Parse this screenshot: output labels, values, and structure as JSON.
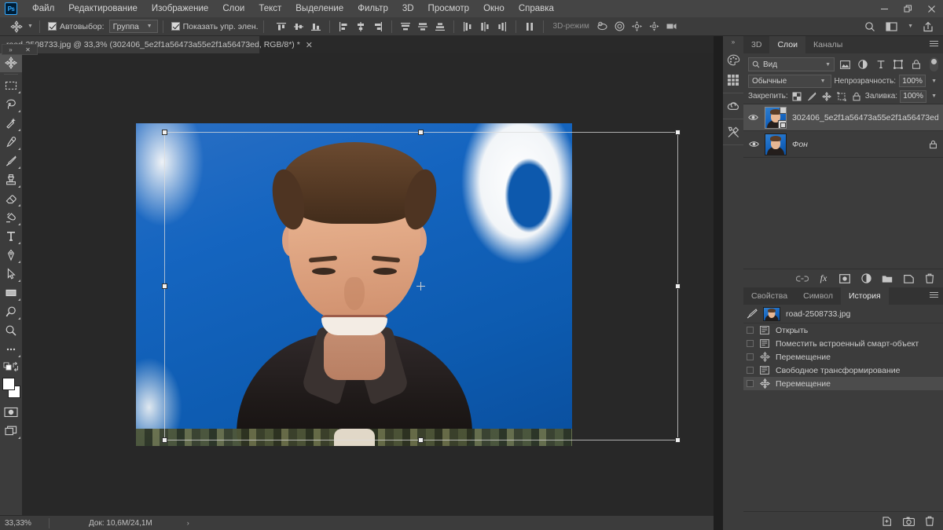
{
  "app": {
    "logo_text": "Ps"
  },
  "menubar": {
    "items": [
      {
        "label": "Файл"
      },
      {
        "label": "Редактирование"
      },
      {
        "label": "Изображение"
      },
      {
        "label": "Слои"
      },
      {
        "label": "Текст"
      },
      {
        "label": "Выделение"
      },
      {
        "label": "Фильтр"
      },
      {
        "label": "3D"
      },
      {
        "label": "Просмотр"
      },
      {
        "label": "Окно"
      },
      {
        "label": "Справка"
      }
    ],
    "window_controls": [
      {
        "name": "minimize",
        "glyph": "–"
      },
      {
        "name": "restore",
        "glyph": "❐"
      },
      {
        "name": "close",
        "glyph": "✕"
      }
    ]
  },
  "optionsbar": {
    "tool_icon": "move-tool-icon",
    "autoselect_label": "Автовыбор:",
    "autoselect_checked": true,
    "autoselect_scope": "Группа",
    "show_controls_label": "Показать упр. элен.",
    "show_controls_checked": true,
    "mode_3d_label": "3D-режим",
    "align_icons": [
      "align-top-edges-icon",
      "align-vertical-centers-icon",
      "align-bottom-edges-icon",
      "align-left-edges-icon",
      "align-horizontal-centers-icon",
      "align-right-edges-icon",
      "distribute-top-icon",
      "distribute-vcenter-icon",
      "distribute-bottom-icon",
      "distribute-left-icon",
      "distribute-hcenter-icon",
      "distribute-right-icon",
      "distribute-spacing-icon"
    ],
    "mode_3d_icons": [
      "rotate-3d-icon",
      "roll-3d-icon",
      "pan-3d-icon",
      "slide-3d-icon",
      "scale-3d-icon"
    ],
    "right_icons": [
      {
        "name": "search-icon",
        "glyph": "⌕"
      },
      {
        "name": "workspace-switcher-icon",
        "glyph": "▣"
      },
      {
        "name": "share-icon",
        "glyph": "⇧"
      }
    ]
  },
  "tabbar": {
    "tab_title": "road-2508733.jpg @ 33,3% (302406_5e2f1a56473a55e2f1a56473ed, RGB/8*) *",
    "close_glyph": "✕",
    "float_left_glyph": "»",
    "float_close_glyph": "✕"
  },
  "toolbox": {
    "tools": [
      {
        "name": "move-tool",
        "active": true,
        "has_flyout": false
      },
      {
        "name": "rectangular-marquee-tool",
        "active": false,
        "has_flyout": true
      },
      {
        "name": "lasso-tool",
        "active": false,
        "has_flyout": true
      },
      {
        "name": "quick-selection-tool",
        "active": false,
        "has_flyout": true
      },
      {
        "name": "eyedropper-tool",
        "active": false,
        "has_flyout": true
      },
      {
        "name": "brush-tool",
        "active": false,
        "has_flyout": true
      },
      {
        "name": "clone-stamp-tool",
        "active": false,
        "has_flyout": true
      },
      {
        "name": "eraser-tool",
        "active": false,
        "has_flyout": true
      },
      {
        "name": "gradient-tool",
        "active": false,
        "has_flyout": true
      },
      {
        "name": "type-tool",
        "active": false,
        "has_flyout": true
      },
      {
        "name": "pen-tool",
        "active": false,
        "has_flyout": true
      },
      {
        "name": "path-selection-tool",
        "active": false,
        "has_flyout": true
      },
      {
        "name": "rectangle-tool",
        "active": false,
        "has_flyout": true
      },
      {
        "name": "dodge-tool",
        "active": false,
        "has_flyout": true
      },
      {
        "name": "zoom-tool",
        "active": false,
        "has_flyout": false
      },
      {
        "name": "edit-toolbar-tool",
        "active": false,
        "has_flyout": true
      }
    ],
    "swap_colors_name": "swap-foreground-background-icon",
    "default_colors_name": "default-colors-icon",
    "foreground_color": "#ffffff",
    "background_color": "#ffffff",
    "quickmask_name": "quick-mask-mode-icon",
    "screenmode_name": "screen-mode-icon"
  },
  "canvas": {
    "image_alt": "portrait-photo-on-blue-backdrop",
    "transform_box_name": "free-transform-bounding-box",
    "handle_count": 8
  },
  "statusbar": {
    "zoom": "33,33%",
    "doc_info": "Док: 10,6M/24,1M",
    "expand_glyph": "›"
  },
  "rail": {
    "collapse_glyph": "»",
    "buttons": [
      {
        "name": "color-swatches-icon"
      },
      {
        "name": "grid-patterns-icon"
      },
      {
        "name": "creative-cloud-libraries-icon"
      },
      {
        "name": "tools-preset-icon"
      }
    ]
  },
  "layers_panel": {
    "tabs": [
      {
        "label": "3D",
        "active": false
      },
      {
        "label": "Слои",
        "active": true
      },
      {
        "label": "Каналы",
        "active": false
      }
    ],
    "filter_placeholder": "Вид",
    "filter_icons": [
      "filter-pixel-icon",
      "filter-adjustment-icon",
      "filter-type-icon",
      "filter-shape-icon",
      "filter-smart-object-icon"
    ],
    "blend_mode": "Обычные",
    "opacity_label": "Непрозрачность:",
    "opacity_value": "100%",
    "lock_label": "Закрепить:",
    "lock_icons": [
      "lock-transparent-pixels-icon",
      "lock-image-pixels-icon",
      "lock-position-icon",
      "lock-artboard-nesting-icon",
      "lock-all-icon"
    ],
    "fill_label": "Заливка:",
    "fill_value": "100%",
    "layers": [
      {
        "name": "302406_5e2f1a56473a55e2f1a56473ed",
        "visible": true,
        "selected": true,
        "is_smart_object": true,
        "locked": false,
        "italic": false
      },
      {
        "name": "Фон",
        "visible": true,
        "selected": false,
        "is_smart_object": false,
        "locked": true,
        "italic": true
      }
    ],
    "footer_icons": [
      {
        "name": "link-layers-icon",
        "glyph": "GO"
      },
      {
        "name": "layer-style-fx-icon",
        "glyph": "fx"
      },
      {
        "name": "add-layer-mask-icon",
        "glyph": "▣"
      },
      {
        "name": "new-adjustment-layer-icon",
        "glyph": "◑"
      },
      {
        "name": "new-group-icon",
        "glyph": "▬"
      },
      {
        "name": "new-layer-icon",
        "glyph": "⧉"
      },
      {
        "name": "delete-layer-icon",
        "glyph": "Ὕ1"
      }
    ]
  },
  "history_panel": {
    "tabs": [
      {
        "label": "Свойства",
        "active": false
      },
      {
        "label": "Символ",
        "active": false
      },
      {
        "label": "История",
        "active": true
      }
    ],
    "snapshot": {
      "name": "road-2508733.jpg",
      "brush_icon": "history-brush-source-icon"
    },
    "states": [
      {
        "label": "Открыть",
        "icon": "history-open-icon",
        "current": false
      },
      {
        "label": "Поместить встроенный смарт-объект",
        "icon": "history-place-icon",
        "current": false
      },
      {
        "label": "Перемещение",
        "icon": "history-move-icon",
        "current": false
      },
      {
        "label": "Свободное трансформирование",
        "icon": "history-transform-icon",
        "current": false
      },
      {
        "label": "Перемещение",
        "icon": "history-move-icon",
        "current": true
      }
    ],
    "footer_icons": [
      {
        "name": "create-document-from-state-icon"
      },
      {
        "name": "create-snapshot-icon"
      },
      {
        "name": "delete-state-icon"
      }
    ]
  },
  "colors": {
    "menubar_bg": "#454545",
    "panel_bg": "#3c3c3c",
    "canvas_bg": "#282828",
    "accent_blue": "#31a8ff",
    "selected_row": "#4f4f4f"
  }
}
